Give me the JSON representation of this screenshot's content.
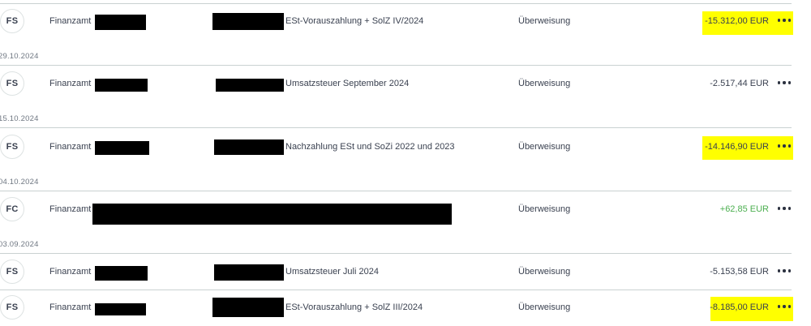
{
  "transactions": [
    {
      "date": "",
      "avatar": "FS",
      "payee": "Finanzamt",
      "purpose": "ESt-Vorauszahlung + SolZ IV/2024",
      "type": "Überweisung",
      "amount": "-15.312,00 EUR",
      "highlighted": true,
      "positive": false
    },
    {
      "date": "29.10.2024",
      "avatar": "FS",
      "payee": "Finanzamt",
      "purpose": "Umsatzsteuer September 2024",
      "type": "Überweisung",
      "amount": "-2.517,44 EUR",
      "highlighted": false,
      "positive": false
    },
    {
      "date": "15.10.2024",
      "avatar": "FS",
      "payee": "Finanzamt",
      "purpose": "Nachzahlung ESt und SoZi 2022 und 2023",
      "type": "Überweisung",
      "amount": "-14.146,90 EUR",
      "highlighted": true,
      "positive": false
    },
    {
      "date": "04.10.2024",
      "avatar": "FC",
      "payee": "Finanzamt",
      "purpose": "",
      "type": "Überweisung",
      "amount": "+62,85 EUR",
      "highlighted": false,
      "positive": true
    },
    {
      "date": "03.09.2024",
      "avatar": "FS",
      "payee": "Finanzamt",
      "purpose": "Umsatzsteuer Juli 2024",
      "type": "Überweisung",
      "amount": "-5.153,58 EUR",
      "highlighted": false,
      "positive": false
    },
    {
      "date": "",
      "avatar": "FS",
      "payee": "Finanzamt",
      "purpose": "ESt-Vorauszahlung + SolZ III/2024",
      "type": "Überweisung",
      "amount": "-8.185,00 EUR",
      "highlighted": true,
      "positive": false
    }
  ],
  "colors": {
    "highlight": "#ffff00",
    "positive_amount": "#4caf50",
    "text": "#3a4150",
    "separator": "#c9d1d1"
  },
  "icons": {
    "more": "more-horizontal-icon"
  }
}
